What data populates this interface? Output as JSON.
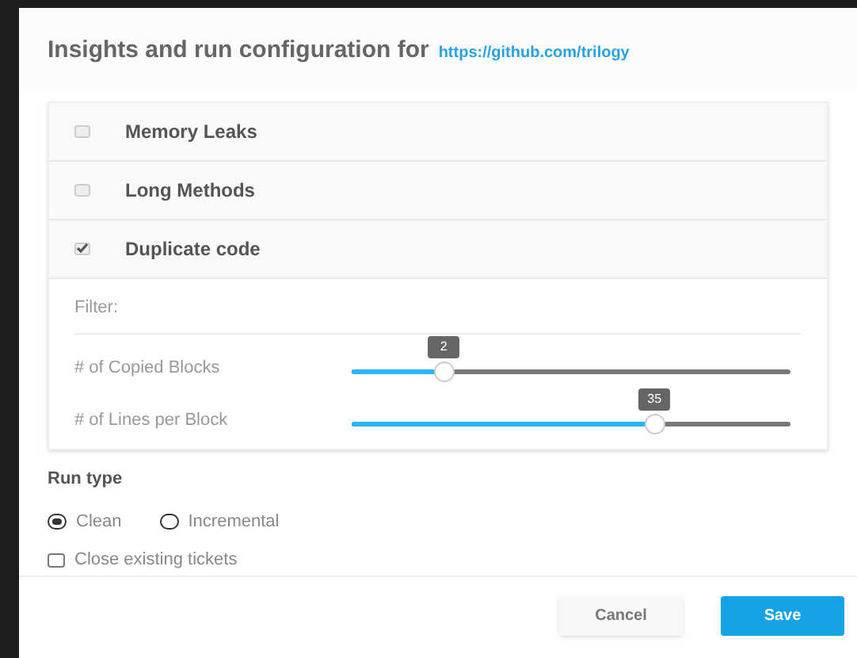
{
  "dialog": {
    "title": "Insights and run configuration for",
    "link": "https://github.com/trilogy"
  },
  "insights": [
    {
      "label": "Memory Leaks",
      "checked": false
    },
    {
      "label": "Long Methods",
      "checked": false
    },
    {
      "label": "Duplicate code",
      "checked": true
    }
  ],
  "filter": {
    "label": "Filter:",
    "sliders": [
      {
        "label": "# of Copied Blocks",
        "value": "2",
        "level": 0.21
      },
      {
        "label": "# of Lines per Block",
        "value": "35",
        "level": 0.69
      }
    ]
  },
  "run_type": {
    "label": "Run type",
    "options": [
      {
        "label": "Clean",
        "selected": true
      },
      {
        "label": "Incremental",
        "selected": false
      }
    ]
  },
  "close_tickets": {
    "label": "Close existing tickets",
    "checked": false
  },
  "buttons": [
    {
      "label": "Cancel",
      "kind": "secondary"
    },
    {
      "label": "Save",
      "kind": "primary"
    }
  ]
}
